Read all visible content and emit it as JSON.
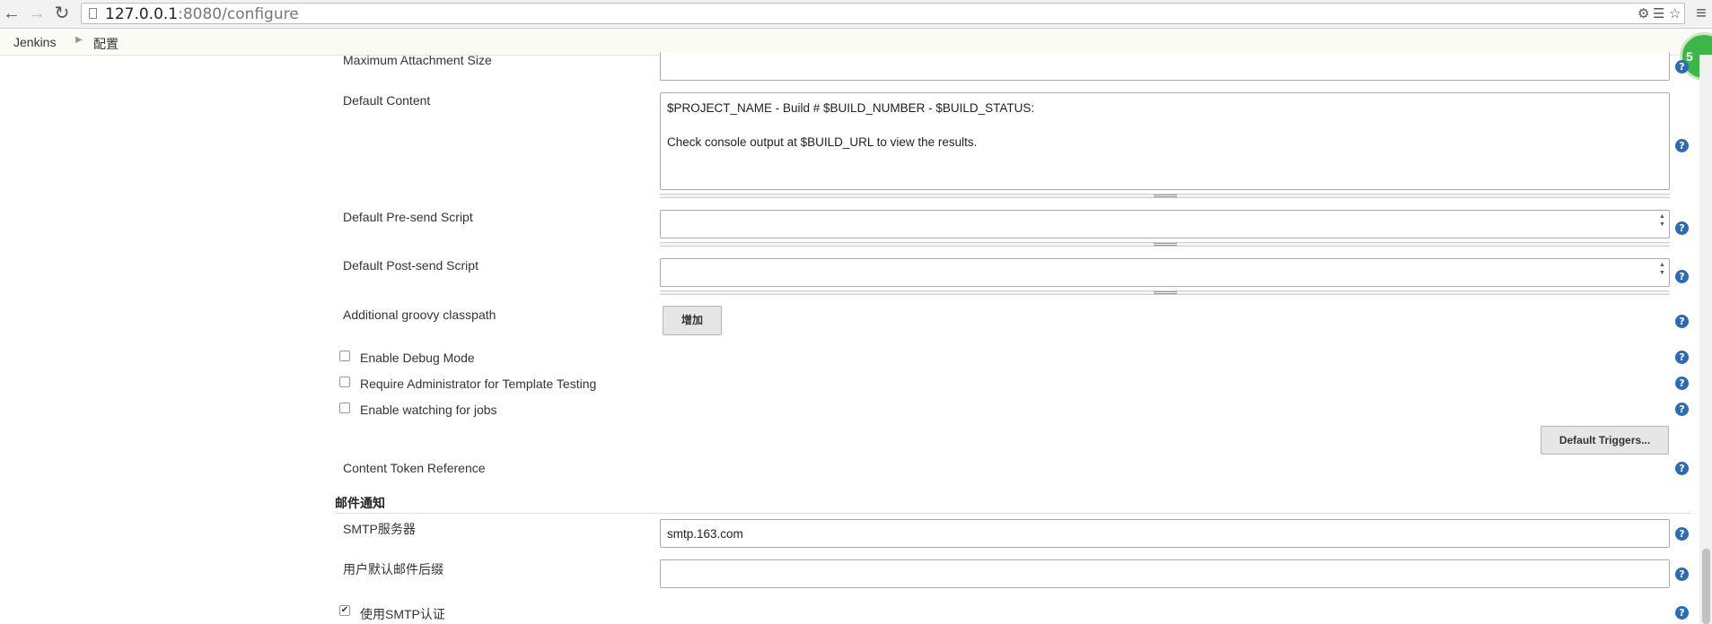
{
  "browser": {
    "url_host": "127.0.0.1",
    "url_rest": ":8080/configure"
  },
  "breadcrumb": {
    "items": [
      "Jenkins",
      "配置"
    ]
  },
  "badge": "5",
  "form": {
    "max_attachment_label": "Maximum Attachment Size",
    "max_attachment_value": "",
    "default_content_label": "Default Content",
    "default_content_value": "$PROJECT_NAME - Build # $BUILD_NUMBER - $BUILD_STATUS:\n\nCheck console output at $BUILD_URL to view the results.",
    "pre_send_label": "Default Pre-send Script",
    "post_send_label": "Default Post-send Script",
    "groovy_label": "Additional groovy classpath",
    "add_button": "增加",
    "debug_label": "Enable Debug Mode",
    "debug_checked": false,
    "admin_label": "Require Administrator for Template Testing",
    "admin_checked": false,
    "watching_label": "Enable watching for jobs",
    "watching_checked": false,
    "triggers_button": "Default Triggers...",
    "token_label": "Content Token Reference"
  },
  "mail_section": {
    "title": "邮件通知",
    "smtp_label": "SMTP服务器",
    "smtp_value": "smtp.163.com",
    "suffix_label": "用户默认邮件后缀",
    "suffix_value": "",
    "use_smtp_auth_label": "使用SMTP认证",
    "use_smtp_auth_checked": true
  },
  "help_glyph": "?"
}
